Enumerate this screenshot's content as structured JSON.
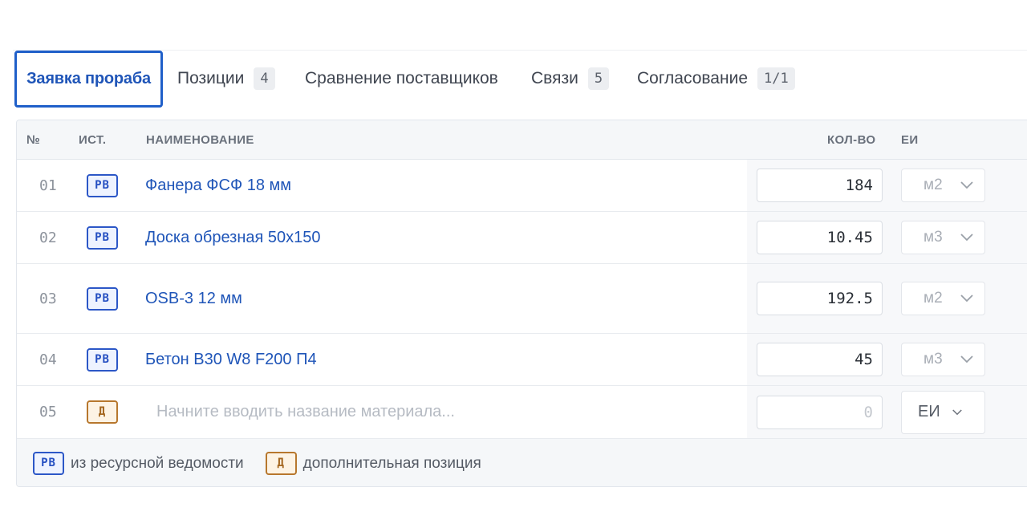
{
  "tabs": [
    {
      "label": "Заявка прораба"
    },
    {
      "label": "Позиции",
      "count": "4"
    },
    {
      "label": "Сравнение поставщиков"
    },
    {
      "label": "Связи",
      "count": "5"
    },
    {
      "label": "Согласование",
      "count": "1/1"
    }
  ],
  "table": {
    "headers": {
      "num": "№",
      "source": "ИСТ.",
      "name": "НАИМЕНОВАНИЕ",
      "qty": "КОЛ-ВО",
      "unit": "ЕИ"
    },
    "rows": [
      {
        "num": "01",
        "source": "РВ",
        "name": "Фанера ФСФ 18 мм",
        "qty": "184",
        "unit": "м2"
      },
      {
        "num": "02",
        "source": "РВ",
        "name": "Доска обрезная 50x150",
        "qty": "10.45",
        "unit": "м3"
      },
      {
        "num": "03",
        "source": "РВ",
        "name": "OSB-3 12 мм",
        "qty": "192.5",
        "unit": "м2"
      },
      {
        "num": "04",
        "source": "РВ",
        "name": "Бетон В30 W8 F200 П4",
        "qty": "45",
        "unit": "м3"
      }
    ],
    "new_row": {
      "num": "05",
      "source": "Д",
      "name_placeholder": "Начните вводить название материала...",
      "qty_placeholder": "0",
      "unit": "ЕИ"
    }
  },
  "legend": {
    "rv_badge": "РВ",
    "rv_text": "из ресурсной ведомости",
    "d_badge": "Д",
    "d_text": "дополнительная позиция"
  },
  "colors": {
    "accent": "#1f55b8",
    "rv_badge": "#2c57c7",
    "d_badge": "#b7772d"
  },
  "icons": {
    "unit_dropdown": "chevron-down-icon"
  }
}
